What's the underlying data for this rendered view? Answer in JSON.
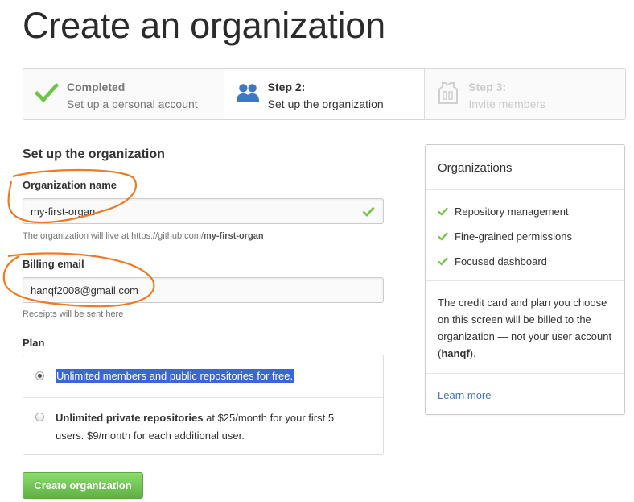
{
  "page": {
    "title": "Create an organization"
  },
  "steps": [
    {
      "title": "Completed",
      "desc": "Set up a personal account",
      "icon": "checkmark-icon",
      "state": "done"
    },
    {
      "title": "Step 2:",
      "desc": "Set up the organization",
      "icon": "people-icon",
      "state": "current"
    },
    {
      "title": "Step 3:",
      "desc": "Invite members",
      "icon": "jersey-icon",
      "state": "future"
    }
  ],
  "form": {
    "section_title": "Set up the organization",
    "org_name": {
      "label": "Organization name",
      "value": "my-first-organ",
      "note_prefix": "The organization will live at https://github.com/",
      "note_suffix": "my-first-organ"
    },
    "billing": {
      "label": "Billing email",
      "value": "hanqf2008@gmail.com",
      "note": "Receipts will be sent here"
    },
    "plan": {
      "label": "Plan",
      "options": [
        {
          "text": "Unlimited members and public repositories for free.",
          "selected": true
        },
        {
          "bold": "Unlimited private repositories",
          "text_line1": " at $25/month for your first 5",
          "text_line2": "users. $9/month for each additional user.",
          "selected": false
        }
      ]
    },
    "submit_label": "Create organization"
  },
  "sidebar": {
    "title": "Organizations",
    "features": [
      "Repository management",
      "Fine-grained permissions",
      "Focused dashboard"
    ],
    "info_prefix": "The credit card and plan you choose on this screen will be billed to the organization — not your user account (",
    "info_user": "hanqf",
    "info_suffix": ").",
    "learn_more": "Learn more"
  },
  "colors": {
    "accent_green": "#6cc644",
    "link_blue": "#4078c0",
    "annotation_orange": "#f07a24",
    "selection_blue": "#3b67d6"
  }
}
